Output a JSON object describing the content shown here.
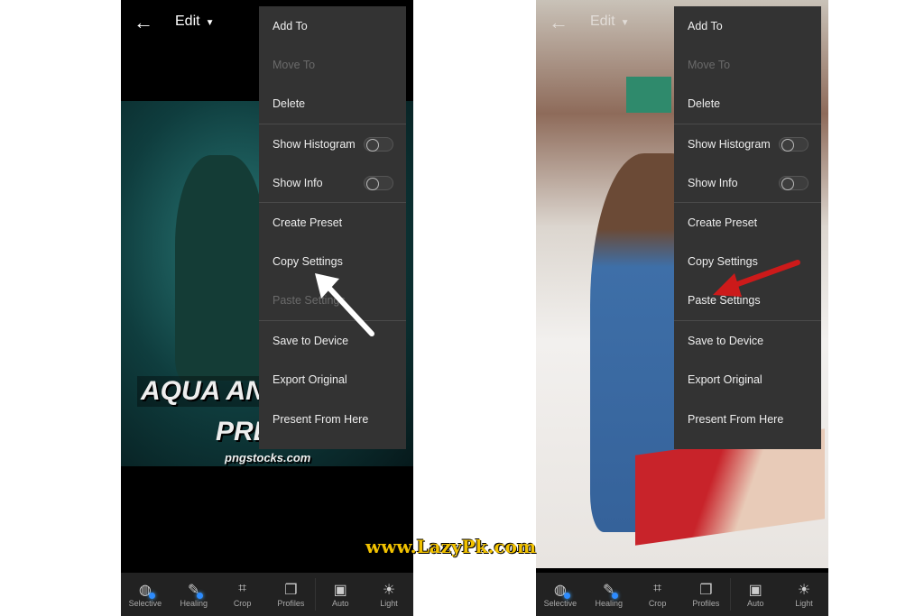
{
  "left_screen": {
    "header": {
      "title": "Edit"
    },
    "photo_text": {
      "line1": "AQUA AN",
      "line2": "PRE",
      "source": "pngstocks.com"
    },
    "menu": [
      {
        "label": "Add To",
        "disabled": false
      },
      {
        "label": "Move To",
        "disabled": true
      },
      {
        "label": "Delete",
        "disabled": false
      },
      {
        "label": "Show Histogram",
        "toggle": false
      },
      {
        "label": "Show Info",
        "toggle": false
      },
      {
        "label": "Create Preset",
        "disabled": false
      },
      {
        "label": "Copy Settings",
        "disabled": false
      },
      {
        "label": "Paste Settings",
        "disabled": true
      },
      {
        "label": "Save to Device",
        "disabled": false
      },
      {
        "label": "Export Original",
        "disabled": false
      },
      {
        "label": "Present From Here",
        "disabled": false
      }
    ],
    "arrow_color": "#ffffff"
  },
  "right_screen": {
    "header": {
      "title": "Edit"
    },
    "menu": [
      {
        "label": "Add To",
        "disabled": false
      },
      {
        "label": "Move To",
        "disabled": true
      },
      {
        "label": "Delete",
        "disabled": false
      },
      {
        "label": "Show Histogram",
        "toggle": false
      },
      {
        "label": "Show Info",
        "toggle": false
      },
      {
        "label": "Create Preset",
        "disabled": false
      },
      {
        "label": "Copy Settings",
        "disabled": false
      },
      {
        "label": "Paste Settings",
        "disabled": false
      },
      {
        "label": "Save to Device",
        "disabled": false
      },
      {
        "label": "Export Original",
        "disabled": false
      },
      {
        "label": "Present From Here",
        "disabled": false
      }
    ],
    "arrow_color": "#cc1a1a"
  },
  "toolbar": [
    {
      "label": "Selective",
      "icon": "selective-icon"
    },
    {
      "label": "Healing",
      "icon": "healing-icon"
    },
    {
      "label": "Crop",
      "icon": "crop-icon"
    },
    {
      "label": "Profiles",
      "icon": "profiles-icon"
    },
    {
      "label": "Auto",
      "icon": "auto-icon"
    },
    {
      "label": "Light",
      "icon": "light-icon"
    }
  ],
  "watermark": "www.LazyPk.com"
}
